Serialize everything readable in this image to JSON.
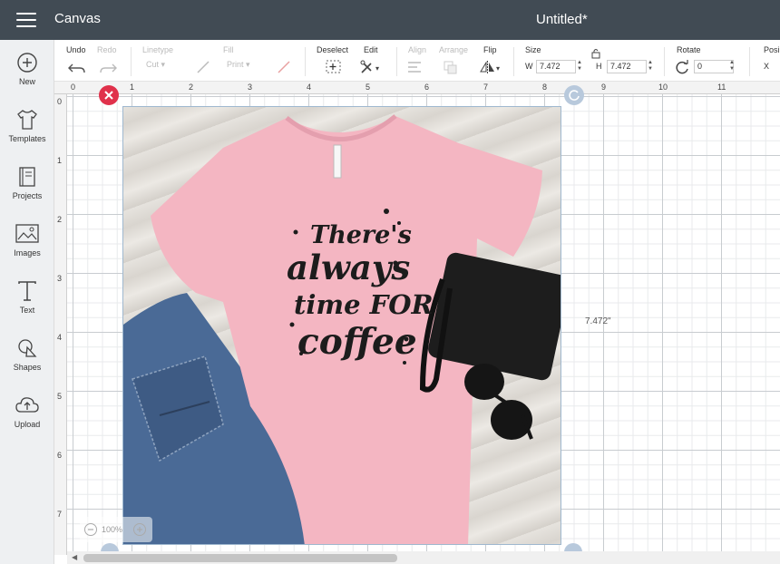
{
  "header": {
    "app_name": "Canvas",
    "doc_title": "Untitled*"
  },
  "toolbar": {
    "undo": "Undo",
    "redo": "Redo",
    "linetype": "Linetype",
    "linetype_value": "Cut",
    "fill": "Fill",
    "fill_value": "Print",
    "deselect": "Deselect",
    "edit": "Edit",
    "align": "Align",
    "arrange": "Arrange",
    "flip": "Flip",
    "size": "Size",
    "width_label": "W",
    "width_value": "7.472",
    "height_label": "H",
    "height_value": "7.472",
    "rotate": "Rotate",
    "rotate_value": "0",
    "position": "Posi",
    "x_label": "X"
  },
  "sidebar": {
    "items": [
      {
        "label": "New",
        "icon": "plus-circle-icon"
      },
      {
        "label": "Templates",
        "icon": "tshirt-icon"
      },
      {
        "label": "Projects",
        "icon": "book-icon"
      },
      {
        "label": "Images",
        "icon": "image-icon"
      },
      {
        "label": "Text",
        "icon": "text-icon"
      },
      {
        "label": "Shapes",
        "icon": "shapes-icon"
      },
      {
        "label": "Upload",
        "icon": "cloud-upload-icon"
      }
    ]
  },
  "ruler": {
    "top": [
      "0",
      "1",
      "2",
      "3",
      "4",
      "5",
      "6",
      "7",
      "8",
      "9",
      "10",
      "11"
    ],
    "left": [
      "0",
      "1",
      "2",
      "3",
      "4",
      "5",
      "6",
      "7"
    ]
  },
  "design": {
    "shirt_text": [
      "There's",
      "always",
      "time FOR",
      "coffee"
    ],
    "width_dimension": "7.472\""
  },
  "zoom": {
    "value": "100%"
  },
  "colors": {
    "header": "#414b54",
    "shirt": "#f4b6c2",
    "delete_handle": "#e0314b",
    "selection": "#9fb8cf"
  }
}
